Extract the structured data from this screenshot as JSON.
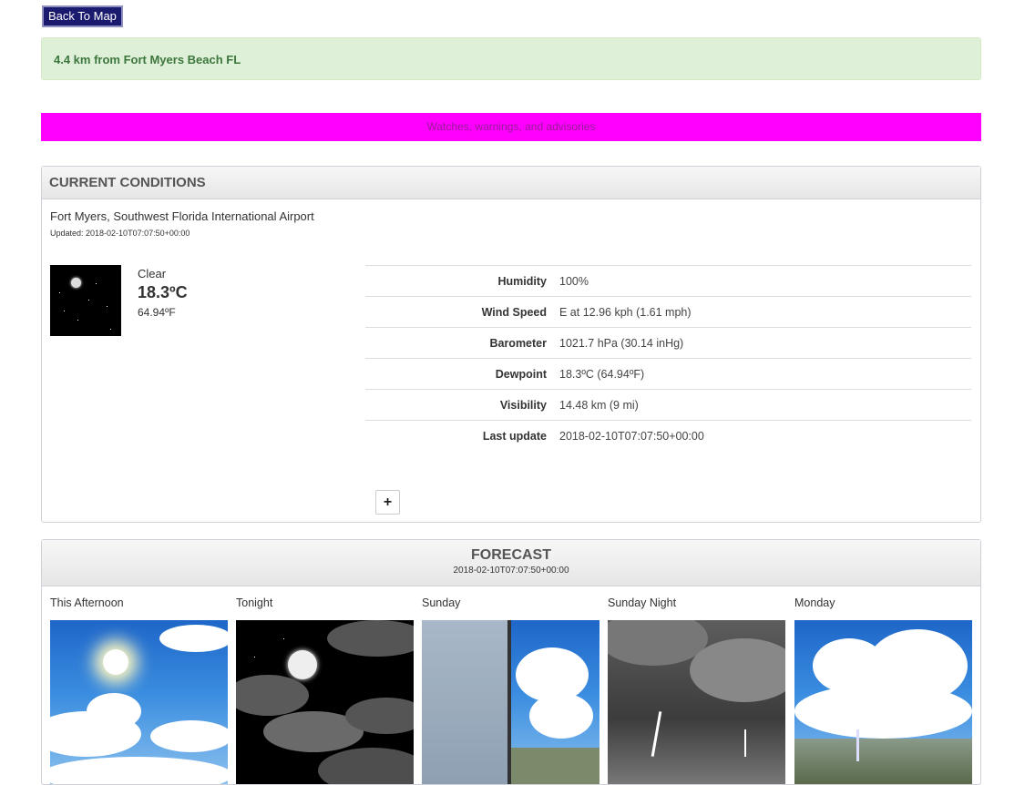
{
  "nav": {
    "back_label": "Back To Map"
  },
  "distance": {
    "text": "4.4 km from Fort Myers Beach FL"
  },
  "alerts": {
    "text": "Watches, warnings, and advisories"
  },
  "current": {
    "header": "CURRENT CONDITIONS",
    "station": "Fort Myers, Southwest Florida International Airport",
    "updated": "Updated: 2018-02-10T07:07:50+00:00",
    "condition": "Clear",
    "temp_c": "18.3ºC",
    "temp_f": "64.94ºF",
    "details": [
      {
        "label": "Humidity",
        "value": "100%"
      },
      {
        "label": "Wind Speed",
        "value": "E at 12.96 kph (1.61 mph)"
      },
      {
        "label": "Barometer",
        "value": "1021.7 hPa (30.14 inHg)"
      },
      {
        "label": "Dewpoint",
        "value": "18.3ºC (64.94ºF)"
      },
      {
        "label": "Visibility",
        "value": "14.48 km (9 mi)"
      },
      {
        "label": "Last update",
        "value": "2018-02-10T07:07:50+00:00"
      }
    ],
    "expand_label": "+"
  },
  "forecast": {
    "header": "FORECAST",
    "date": "2018-02-10T07:07:50+00:00",
    "periods": [
      {
        "label": "This Afternoon",
        "icon": "sunny-icon"
      },
      {
        "label": "Tonight",
        "icon": "night-partly-cloudy-icon"
      },
      {
        "label": "Sunday",
        "icon": "fog-thunderstorm-icon"
      },
      {
        "label": "Sunday Night",
        "icon": "thunderstorm-icon"
      },
      {
        "label": "Monday",
        "icon": "thunderstorm-icon"
      }
    ]
  }
}
